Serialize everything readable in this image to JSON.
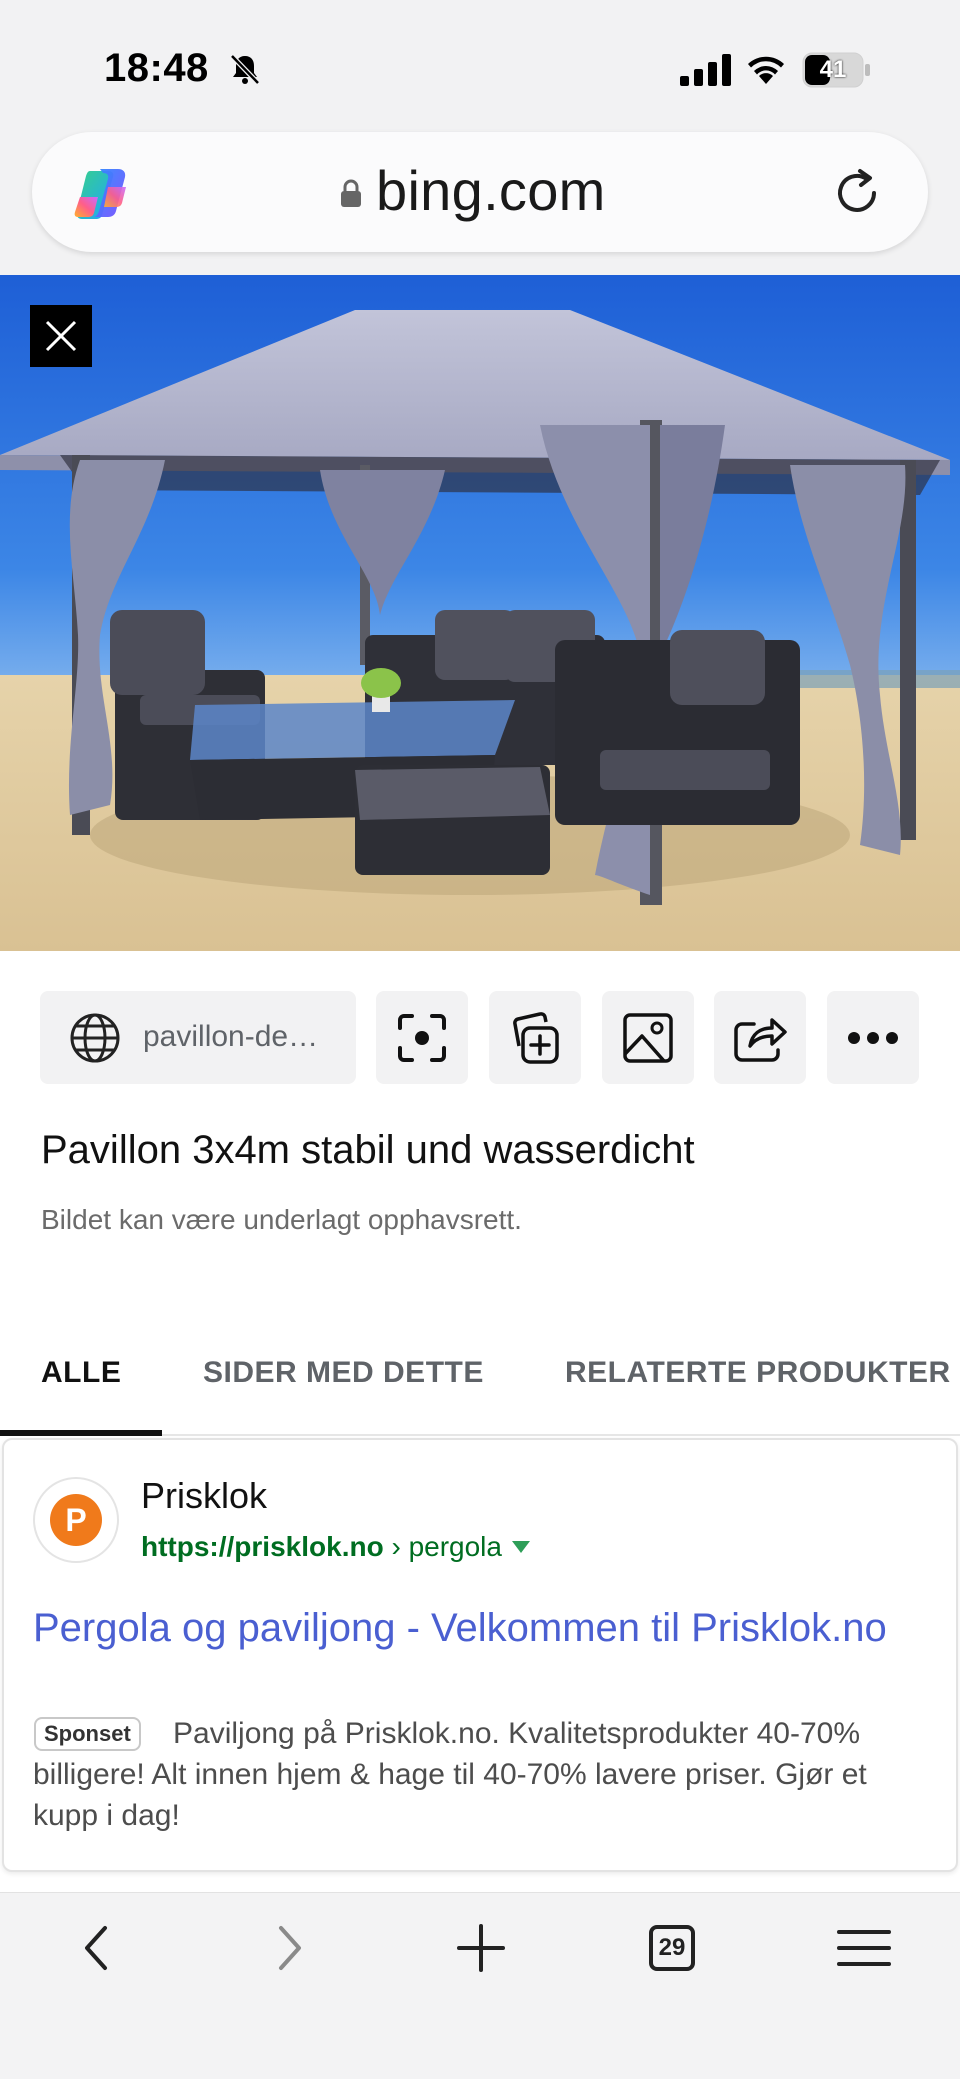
{
  "status_bar": {
    "time": "18:48",
    "battery": "41"
  },
  "browser": {
    "url": "bing.com",
    "tab_count": "29"
  },
  "image_viewer": {
    "source_label": "pavillon-de…",
    "title": "Pavillon 3x4m stabil und wasserdicht",
    "copyright_notice": "Bildet kan være underlagt opphavsrett."
  },
  "tabs": [
    {
      "label": "ALLE",
      "active": true
    },
    {
      "label": "SIDER MED DETTE",
      "active": false
    },
    {
      "label": "RELATERTE PRODUKTER",
      "active": false
    }
  ],
  "result": {
    "favicon_letter": "P",
    "site_name": "Prisklok",
    "url_bold": "https://prisklok.no",
    "url_path": " › pergola",
    "title": "Pergola og paviljong - Velkommen til Prisklok.no",
    "badge": "Sponset",
    "snippet": "Paviljong på Prisklok.no. Kvalitetsprodukter 40-70% billigere! Alt innen hjem & hage til 40-70% lavere priser. Gjør et kupp i dag!"
  },
  "colors": {
    "link": "#4a5fd1",
    "url_green": "#006d21",
    "favicon_orange": "#f07a1b"
  }
}
